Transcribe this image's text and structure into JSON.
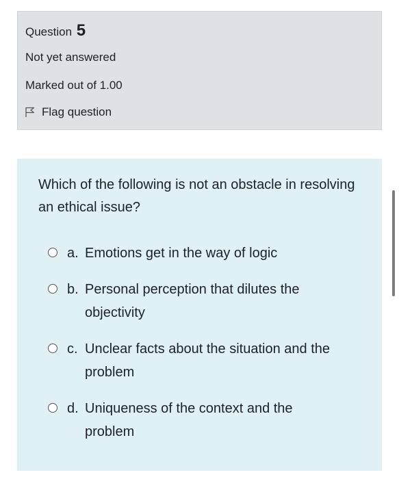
{
  "info": {
    "question_label": "Question",
    "question_number": "5",
    "state": "Not yet answered",
    "grade": "Marked out of 1.00",
    "flag_label": "Flag question"
  },
  "question": {
    "text": "Which of the following is not an obstacle in resolving an ethical issue?",
    "options": [
      {
        "letter": "a.",
        "text": "Emotions get in the way of logic"
      },
      {
        "letter": "b.",
        "text": "Personal perception that dilutes the objectivity"
      },
      {
        "letter": "c.",
        "text": "Unclear facts about the situation and the problem"
      },
      {
        "letter": "d.",
        "text": "Uniqueness of the context and the problem"
      }
    ]
  },
  "colors": {
    "info_bg": "#dee2e6",
    "formulation_bg": "#e0f1f6",
    "text": "#1d2125"
  }
}
